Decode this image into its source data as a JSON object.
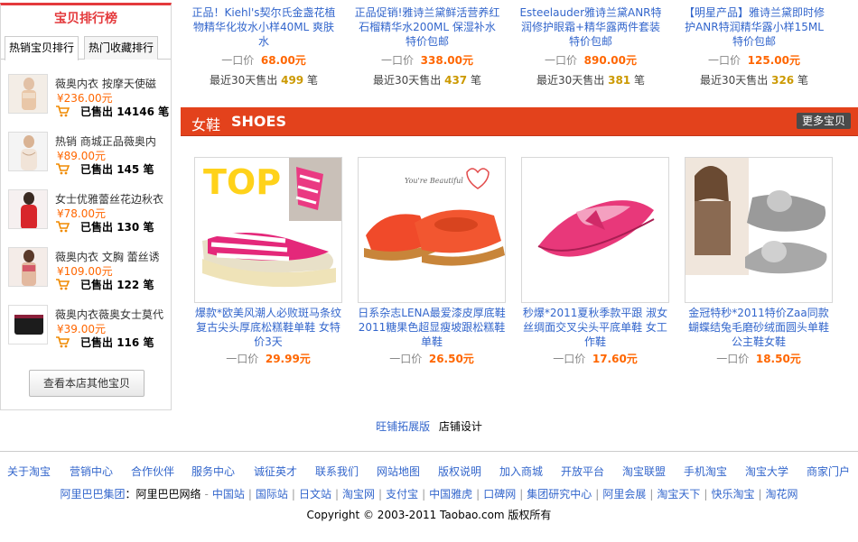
{
  "sidebar": {
    "title": "宝贝排行榜",
    "tabs": [
      "热销宝贝排行",
      "热门收藏排行"
    ],
    "items": [
      {
        "name": "薇奥内衣 按摩天使磁",
        "price": "¥236.00元",
        "sold_label": "已售出",
        "sold": "14146",
        "unit": "笔"
      },
      {
        "name": "热销 商城正品薇奥内",
        "price": "¥89.00元",
        "sold_label": "已售出",
        "sold": "145",
        "unit": "笔"
      },
      {
        "name": "女士优雅蕾丝花边秋衣",
        "price": "¥78.00元",
        "sold_label": "已售出",
        "sold": "130",
        "unit": "笔"
      },
      {
        "name": "薇奥内衣 文胸 蕾丝诱",
        "price": "¥109.00元",
        "sold_label": "已售出",
        "sold": "122",
        "unit": "笔"
      },
      {
        "name": "薇奥内衣薇奥女士莫代",
        "price": "¥39.00元",
        "sold_label": "已售出",
        "sold": "116",
        "unit": "笔"
      }
    ],
    "more_button": "查看本店其他宝贝"
  },
  "top_products": [
    {
      "name": "正品！Kiehl's契尔氏金盏花植物精华化妆水小样40ML 爽肤水",
      "price_label": "一口价",
      "price": "68.00元",
      "sold_prefix": "最近30天售出",
      "sold": "499",
      "unit": "笔"
    },
    {
      "name": "正品促销!雅诗兰黛鲜活营养红石榴精华水200ML 保湿补水 特价包邮",
      "price_label": "一口价",
      "price": "338.00元",
      "sold_prefix": "最近30天售出",
      "sold": "437",
      "unit": "笔"
    },
    {
      "name": "Esteelauder雅诗兰黛ANR特润修护眼霜+精华露两件套装 特价包邮",
      "price_label": "一口价",
      "price": "890.00元",
      "sold_prefix": "最近30天售出",
      "sold": "381",
      "unit": "笔"
    },
    {
      "name": "【明星产品】雅诗兰黛即时修护ANR特润精华露小样15ML 特价包邮",
      "price_label": "一口价",
      "price": "125.00元",
      "sold_prefix": "最近30天售出",
      "sold": "326",
      "unit": "笔"
    }
  ],
  "shoes_section": {
    "title_cn": "女鞋",
    "title_en": "SHOES",
    "more": "更多宝贝",
    "top_badge": "TOP",
    "brand_text": "You're Beautiful",
    "products": [
      {
        "name": "爆款*欧美风潮人必败斑马条纹 复古尖头厚底松糕鞋单鞋 女特价3天",
        "price_label": "一口价",
        "price": "29.99元"
      },
      {
        "name": "日系杂志LENA最爱漆皮厚底鞋2011糖果色超显瘦坡跟松糕鞋单鞋",
        "price_label": "一口价",
        "price": "26.50元"
      },
      {
        "name": "秒爆*2011夏秋季款平跟 淑女丝绸面交叉尖头平底单鞋 女工作鞋",
        "price_label": "一口价",
        "price": "17.60元"
      },
      {
        "name": "金冠特秒*2011特价Zaa同款蝴蝶结兔毛磨砂绒面圆头单鞋 公主鞋女鞋",
        "price_label": "一口价",
        "price": "18.50元"
      }
    ]
  },
  "shop_links": {
    "expand": "旺铺拓展版",
    "design": "店铺设计"
  },
  "footer": {
    "nav": [
      "关于淘宝",
      "营销中心",
      "合作伙伴",
      "服务中心",
      "诚征英才",
      "联系我们",
      "网站地图",
      "版权说明",
      "加入商城",
      "开放平台",
      "淘宝联盟",
      "手机淘宝",
      "淘宝大学",
      "商家门户"
    ],
    "group_label": "阿里巴巴集团",
    "group_network": "阿里巴巴网络",
    "group_links": [
      "中国站",
      "国际站",
      "日文站",
      "淘宝网",
      "支付宝",
      "中国雅虎",
      "口碑网",
      "集团研究中心",
      "阿里会展",
      "淘宝天下",
      "快乐淘宝",
      "淘花网"
    ],
    "copyright": "Copyright © 2003-2011 Taobao.com 版权所有"
  },
  "colors": {
    "accent": "#e4393c",
    "section_bar": "#e3421c",
    "link": "#3366cc",
    "price": "#ff6600",
    "sold": "#cc9900"
  }
}
